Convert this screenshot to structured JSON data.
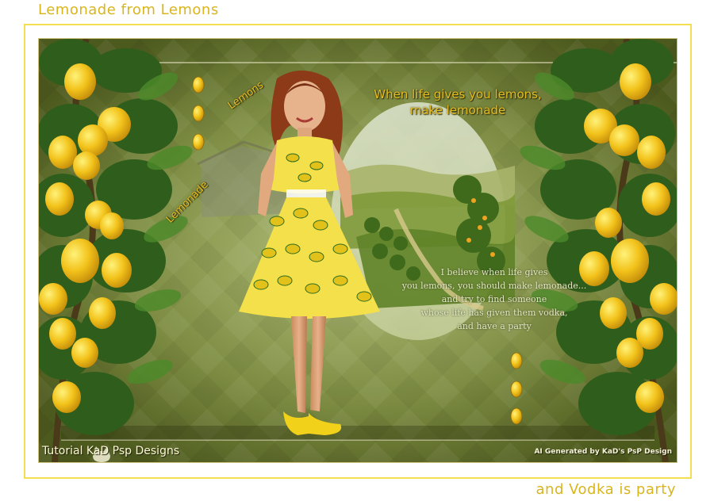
{
  "header": {
    "title": "Lemonade from Lemons"
  },
  "footer": {
    "tagline": "and Vodka is party"
  },
  "artwork": {
    "quote_heading_lines": [
      "When life gives you lemons,",
      "make lemonade"
    ],
    "label_lemons": "Lemons",
    "label_lemonade": "Lemonade",
    "quote_body_lines": [
      "I believe when life gives",
      "you lemons, you should make lemonade...",
      "and try to find someone",
      "whose life has given them vodka,",
      "and have a party"
    ],
    "signature": "Tutorial KaD Psp Designs",
    "credit": "AI Generated by KaD's PsP Design"
  },
  "colors": {
    "title_yellow": "#d9b51e",
    "frame_yellow": "#f4df52",
    "olive_background": "#6c7b38",
    "lemon": "#f2c21a",
    "leaf": "#2f5d1c",
    "dress_yellow": "#f3e04a"
  },
  "icons": {
    "lemon_drop_bullets": "lemon-drop-icon",
    "signature_logo": "cat-logo-icon"
  }
}
